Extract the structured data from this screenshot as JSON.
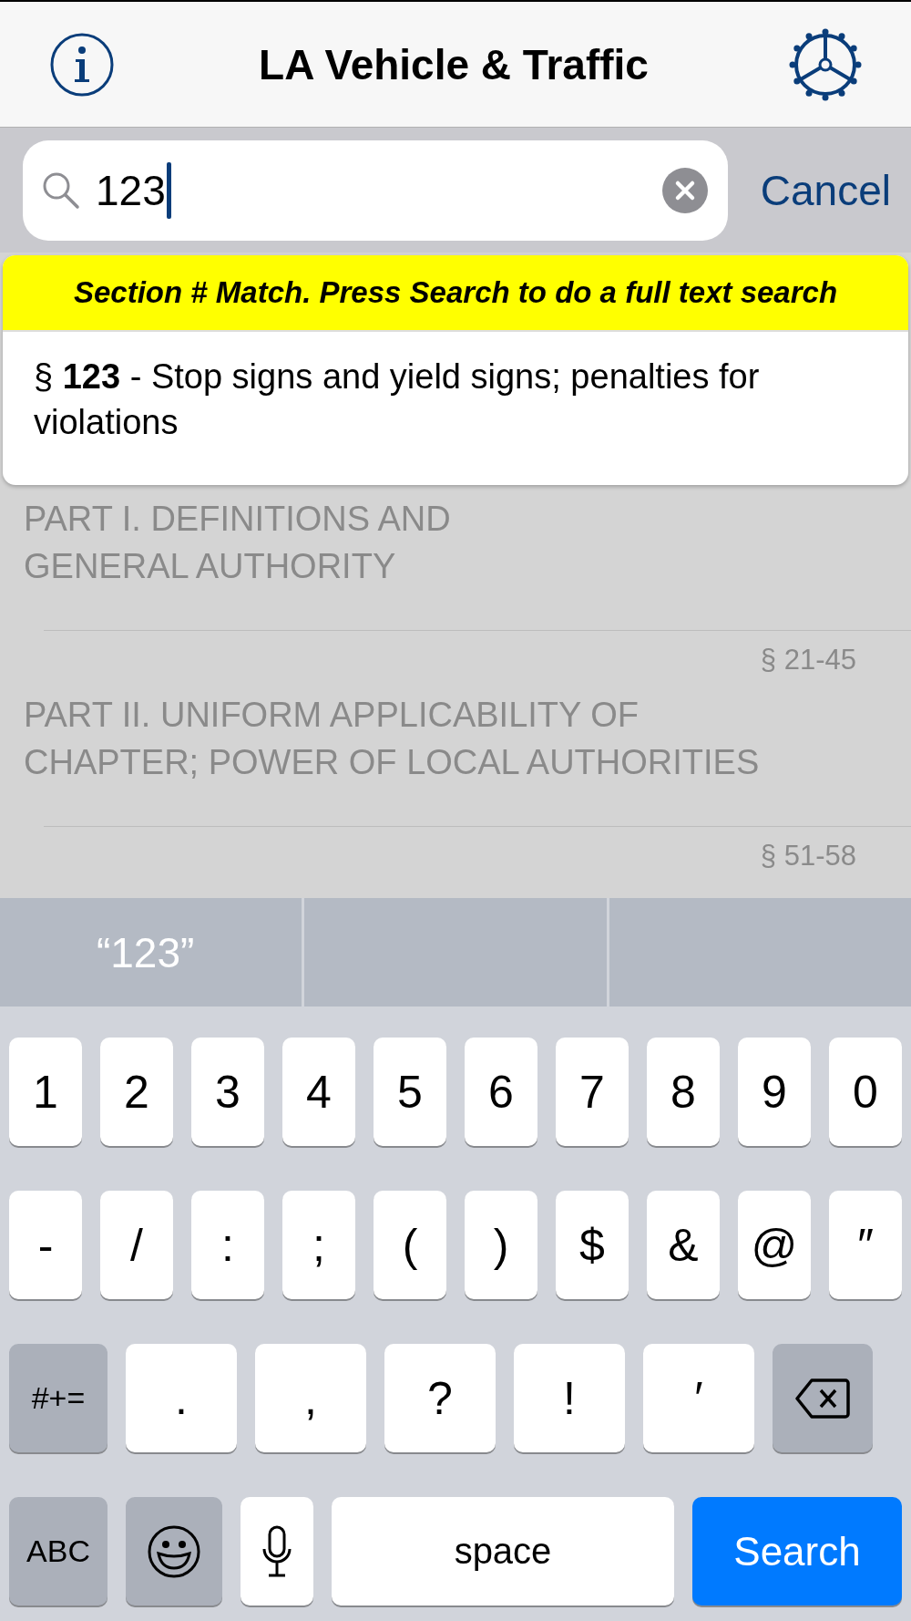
{
  "header": {
    "title": "LA Vehicle & Traffic"
  },
  "search": {
    "value": "123",
    "cancel": "Cancel"
  },
  "dropdown": {
    "banner": "Section # Match. Press Search to do a full text search",
    "results": [
      {
        "text": "§ **123** - Stop signs and yield signs; penalties for violations"
      }
    ]
  },
  "list": {
    "rows": [
      {
        "title": "PART I. DEFINITIONS AND\nGENERAL AUTHORITY"
      },
      {
        "range": "§ 21-45",
        "title": "PART II. UNIFORM APPLICABILITY OF\nCHAPTER; POWER OF LOCAL AUTHORITIES"
      },
      {
        "range": "§ 51-58"
      }
    ]
  },
  "suggestions": [
    {
      "text": "“123”"
    }
  ],
  "keyboard": {
    "rows": [
      {
        "keys": [
          {
            "kind": "char",
            "label": "1"
          },
          {
            "kind": "char",
            "label": "2"
          },
          {
            "kind": "char",
            "label": "3"
          },
          {
            "kind": "char",
            "label": "4"
          },
          {
            "kind": "char",
            "label": "5"
          },
          {
            "kind": "char",
            "label": "6"
          },
          {
            "kind": "char",
            "label": "7"
          },
          {
            "kind": "char",
            "label": "8"
          },
          {
            "kind": "char",
            "label": "9"
          },
          {
            "kind": "char",
            "label": "0"
          }
        ]
      },
      {
        "keys": [
          {
            "kind": "char",
            "label": "-"
          },
          {
            "kind": "char",
            "label": "/"
          },
          {
            "kind": "char",
            "label": ":"
          },
          {
            "kind": "char",
            "label": ";"
          },
          {
            "kind": "char",
            "label": "("
          },
          {
            "kind": "char",
            "label": ")"
          },
          {
            "kind": "char",
            "label": "$"
          },
          {
            "kind": "char",
            "label": "&"
          },
          {
            "kind": "char",
            "label": "@"
          },
          {
            "kind": "char",
            "label": "″"
          }
        ]
      },
      {
        "keys": [
          {
            "kind": "function",
            "label": "#+="
          },
          {
            "kind": "wide",
            "label": "."
          },
          {
            "kind": "wide",
            "label": ","
          },
          {
            "kind": "wide",
            "label": "?"
          },
          {
            "kind": "wide",
            "label": "!"
          },
          {
            "kind": "wide",
            "label": "′"
          },
          {
            "kind": "delete"
          }
        ]
      },
      {
        "keys": [
          {
            "kind": "function",
            "label": "ABC"
          },
          {
            "kind": "emoji"
          },
          {
            "kind": "mic"
          },
          {
            "kind": "space",
            "label": "space"
          },
          {
            "kind": "primary",
            "label": "Search"
          }
        ]
      }
    ]
  }
}
